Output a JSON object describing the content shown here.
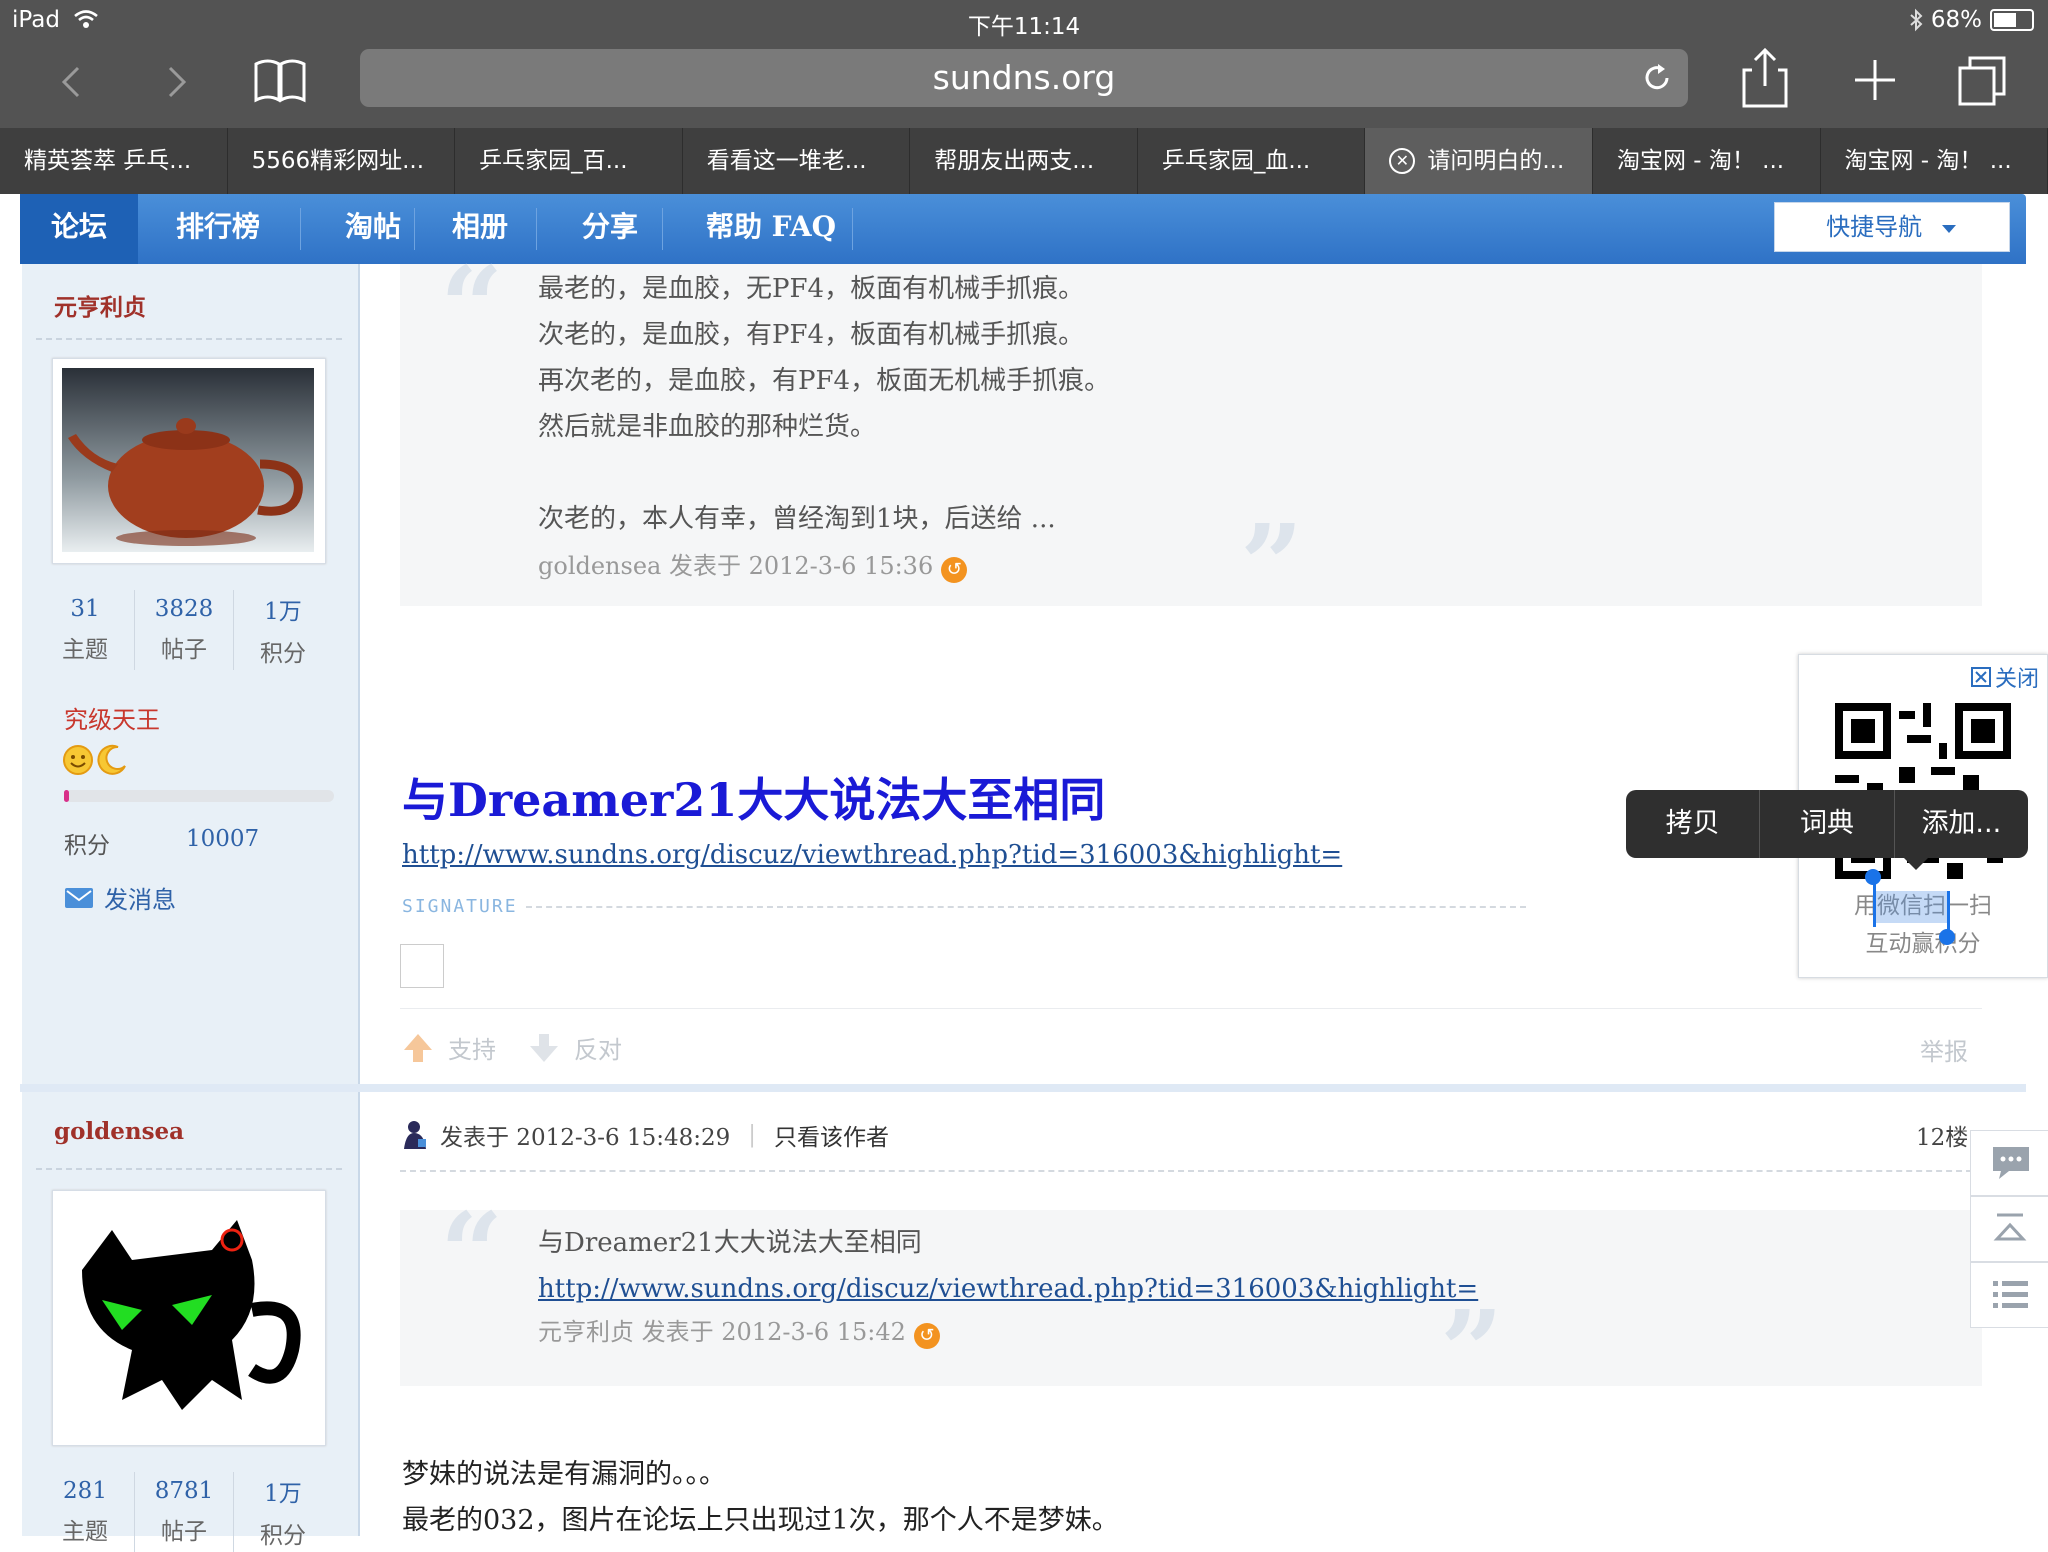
{
  "status_bar": {
    "device": "iPad",
    "time": "下午11:14",
    "battery": "68%",
    "battery_level": 0.68
  },
  "browser": {
    "url": "sundns.org",
    "tabs": [
      {
        "label": "精英荟萃 乒乓..."
      },
      {
        "label": "5566精彩网址..."
      },
      {
        "label": "乒乓家园_百..."
      },
      {
        "label": "看看这一堆老..."
      },
      {
        "label": "帮朋友出两支..."
      },
      {
        "label": "乒乓家园_血..."
      },
      {
        "label": "请问明白的...",
        "active": true
      },
      {
        "label": "淘宝网 - 淘！ ..."
      },
      {
        "label": "淘宝网 - 淘！ ..."
      }
    ]
  },
  "forum_nav": {
    "items": [
      "论坛",
      "排行榜",
      "淘帖",
      "相册",
      "分享",
      "帮助 FAQ"
    ],
    "quick_nav": "快捷导航"
  },
  "post1": {
    "author": "元亨利贞",
    "stats": [
      {
        "num": "31",
        "label": "主题"
      },
      {
        "num": "3828",
        "label": "帖子"
      },
      {
        "num": "1万",
        "label": "积分"
      }
    ],
    "rank": "究级天王",
    "points_label": "积分",
    "points_value": "10007",
    "send_message": "发消息",
    "quote_lines": [
      "最老的，是血胶，无PF4，板面有机械手抓痕。",
      "次老的，是血胶，有PF4，板面有机械手抓痕。",
      "再次老的，是血胶，有PF4，板面无机械手抓痕。",
      "然后就是非血胶的那种烂货。"
    ],
    "quote_line5": "次老的，本人有幸，曾经淘到1块，后送给 ...",
    "quote_meta": "goldensea 发表于 2012-3-6 15:36",
    "body_title": "与Dreamer21大大说法大至相同",
    "body_link": "http://www.sundns.org/discuz/viewthread.php?tid=316003&highlight=",
    "signature_label": "SIGNATURE",
    "support": "支持",
    "oppose": "反对",
    "report": "举报"
  },
  "post2": {
    "author": "goldensea",
    "stats": [
      {
        "num": "281",
        "label": "主题"
      },
      {
        "num": "8781",
        "label": "帖子"
      },
      {
        "num": "1万",
        "label": "积分"
      }
    ],
    "posted_at": "发表于 2012-3-6 15:48:29",
    "only_author": "只看该作者",
    "floor": "12楼",
    "quote_title": "与Dreamer21大大说法大至相同",
    "quote_link": "http://www.sundns.org/discuz/viewthread.php?tid=316003&highlight=",
    "quote_meta": "元亨利贞 发表于 2012-3-6 15:42",
    "body_lines": [
      "梦妹的说法是有漏洞的。。。",
      "最老的032，图片在论坛上只出现过1次，那个人不是梦妹。"
    ]
  },
  "qr_panel": {
    "close": "关闭",
    "line1": "用微信扫一扫",
    "line2": "互动赢积分"
  },
  "context_menu": {
    "items": [
      "拷贝",
      "词典",
      "添加..."
    ]
  }
}
